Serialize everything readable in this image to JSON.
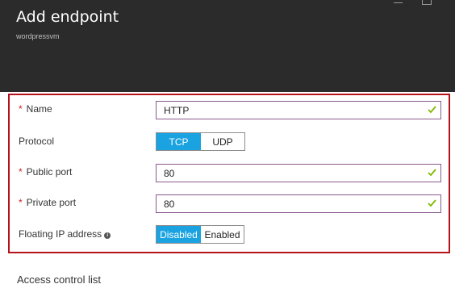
{
  "header": {
    "title": "Add endpoint",
    "subtitle": "wordpressvm"
  },
  "form": {
    "name": {
      "label": "Name",
      "value": "HTTP",
      "required": true
    },
    "protocol": {
      "label": "Protocol",
      "options": [
        "TCP",
        "UDP"
      ],
      "selected": "TCP"
    },
    "public_port": {
      "label": "Public port",
      "value": "80",
      "required": true
    },
    "private_port": {
      "label": "Private port",
      "value": "80",
      "required": true
    },
    "floating_ip": {
      "label": "Floating IP address",
      "options": [
        "Disabled",
        "Enabled"
      ],
      "selected": "Disabled"
    },
    "required_marker": "*"
  },
  "acl": {
    "label": "Access control list"
  },
  "colors": {
    "header_bg": "#2b2b2b",
    "highlight_border": "#b5121b",
    "toggle_active": "#1aa3e0",
    "valid_check": "#7fba00",
    "required_star": "#d01e1e"
  },
  "icons": {
    "valid": "checkmark-icon",
    "info": "info-icon",
    "minimize": "minimize-icon",
    "maximize": "maximize-icon"
  }
}
